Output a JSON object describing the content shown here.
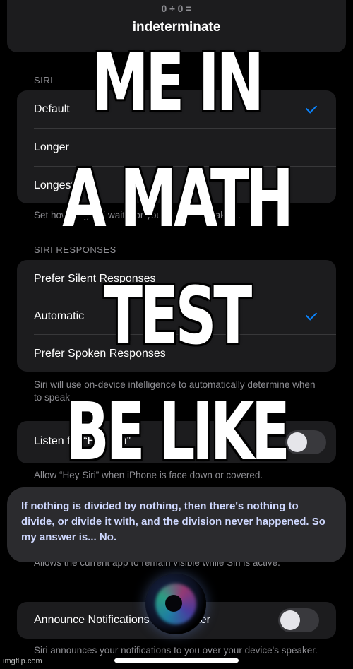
{
  "top_card": {
    "equation": "0 ÷ 0 =",
    "result": "indeterminate"
  },
  "siri_pause_section": {
    "header": "SIRI",
    "options": [
      "Default",
      "Longer",
      "Longest"
    ],
    "selected": "Default",
    "footer": "Set how long Siri waits for you to finish speaking."
  },
  "siri_responses_section": {
    "header": "SIRI RESPONSES",
    "options": [
      "Prefer Silent Responses",
      "Automatic",
      "Prefer Spoken Responses"
    ],
    "selected": "Automatic",
    "footer": "Siri will use on-device intelligence to automatically determine when to speak."
  },
  "hey_siri": {
    "label": "Listen for “Hey Siri”",
    "footer": "Allow “Hey Siri” when iPhone is face down or covered."
  },
  "siri_answer": "If nothing is divided by nothing, then there's nothing to divide, or divide it with, and the division never happened. So my answer is... No.",
  "allow_footer": "Allows the current app to remain visible while Siri is active.",
  "announce": {
    "label": "Announce Notifications on Speaker",
    "footer": "Siri announces your notifications to you over your device's speaker.",
    "on": false
  },
  "meme_text": {
    "line1": "ME IN",
    "line2": "A MATH",
    "line3": "TEST",
    "line4": "BE LIKE"
  },
  "watermark": "imgflip.com",
  "colors": {
    "accent": "#0a84ff",
    "card": "#1c1c1e",
    "background": "#000000"
  }
}
